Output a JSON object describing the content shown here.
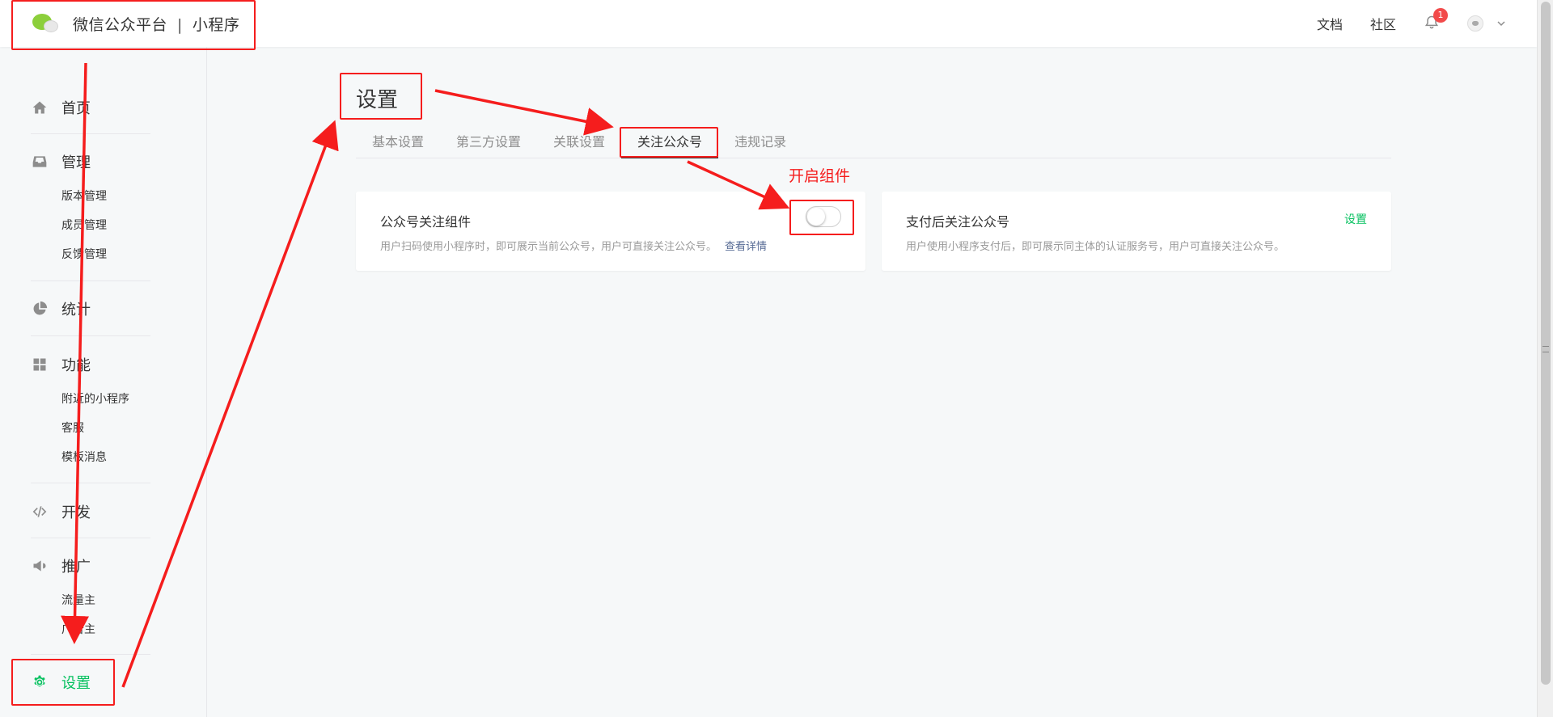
{
  "header": {
    "app_name": "微信公众平台",
    "separator": "|",
    "product": "小程序",
    "links": [
      "文档",
      "社区"
    ],
    "notification_count": "1",
    "logo_icon": "wechat-logo-icon"
  },
  "sidebar": {
    "groups": [
      {
        "label": "首页",
        "icon": "home-icon",
        "subitems": []
      },
      {
        "label": "管理",
        "icon": "inbox-icon",
        "subitems": [
          "版本管理",
          "成员管理",
          "反馈管理"
        ]
      },
      {
        "label": "统计",
        "icon": "pie-chart-icon",
        "subitems": []
      },
      {
        "label": "功能",
        "icon": "grid-icon",
        "subitems": [
          "附近的小程序",
          "客服",
          "模板消息"
        ]
      },
      {
        "label": "开发",
        "icon": "code-icon",
        "subitems": []
      },
      {
        "label": "推广",
        "icon": "megaphone-icon",
        "subitems": [
          "流量主",
          "广告主"
        ]
      },
      {
        "label": "设置",
        "icon": "gear-icon",
        "subitems": [],
        "active": true
      }
    ]
  },
  "main": {
    "title": "设置",
    "tabs": [
      "基本设置",
      "第三方设置",
      "关联设置",
      "关注公众号",
      "违规记录"
    ],
    "active_tab": "关注公众号",
    "cards": [
      {
        "title": "公众号关注组件",
        "desc": "用户扫码使用小程序时，即可展示当前公众号，用户可直接关注公众号。",
        "link": "查看详情",
        "switch_on": false
      },
      {
        "title": "支付后关注公众号",
        "desc": "用户使用小程序支付后，即可展示同主体的认证服务号，用户可直接关注公众号。",
        "action": "设置"
      }
    ]
  },
  "annotations": {
    "label": "开启组件",
    "color": "#f51d1d"
  },
  "colors": {
    "accent_green": "#07c160",
    "link_blue": "#576b95",
    "badge_red": "#f24a4a"
  }
}
